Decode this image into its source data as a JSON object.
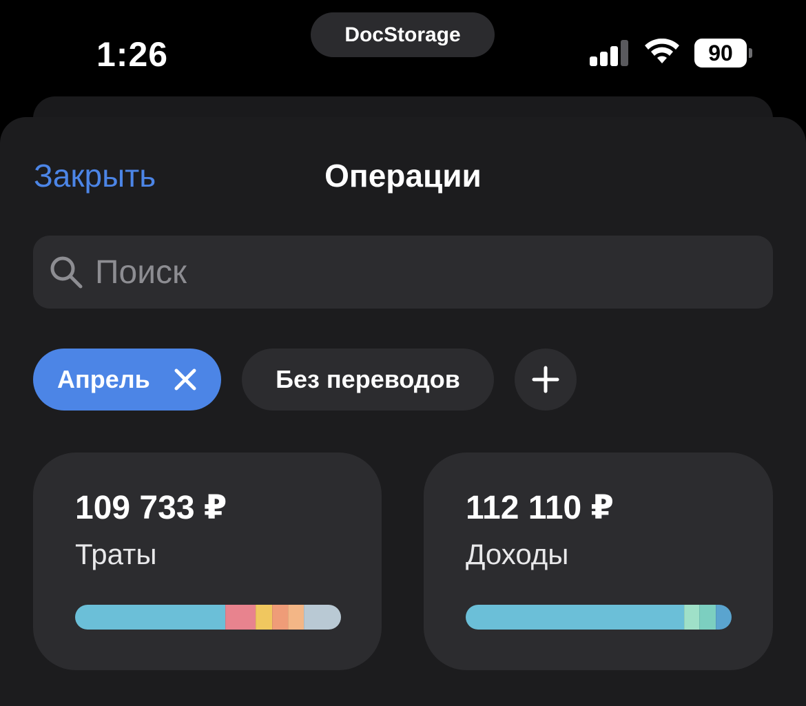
{
  "status_bar": {
    "time": "1:26",
    "island_label": "DocStorage",
    "battery": "90"
  },
  "header": {
    "close_label": "Закрыть",
    "title": "Операции"
  },
  "search": {
    "placeholder": "Поиск"
  },
  "filters": {
    "month_chip": "Апрель",
    "transfers_chip": "Без переводов"
  },
  "colors": {
    "accent": "#4c85e6"
  },
  "cards": {
    "spend": {
      "amount": "109 733 ₽",
      "label": "Траты",
      "segments": [
        {
          "share": 0.565,
          "color": "#6bbfd8"
        },
        {
          "share": 0.115,
          "color": "#e8838e"
        },
        {
          "share": 0.06,
          "color": "#f0c75f"
        },
        {
          "share": 0.06,
          "color": "#ef9c78"
        },
        {
          "share": 0.06,
          "color": "#f3b686"
        },
        {
          "share": 0.14,
          "color": "#b9c9d4"
        }
      ]
    },
    "income": {
      "amount": "112 110 ₽",
      "label": "Доходы",
      "segments": [
        {
          "share": 0.82,
          "color": "#6bbfd8"
        },
        {
          "share": 0.058,
          "color": "#9fe0c8"
        },
        {
          "share": 0.062,
          "color": "#7ccfc0"
        },
        {
          "share": 0.06,
          "color": "#5aa4cf"
        }
      ]
    }
  }
}
